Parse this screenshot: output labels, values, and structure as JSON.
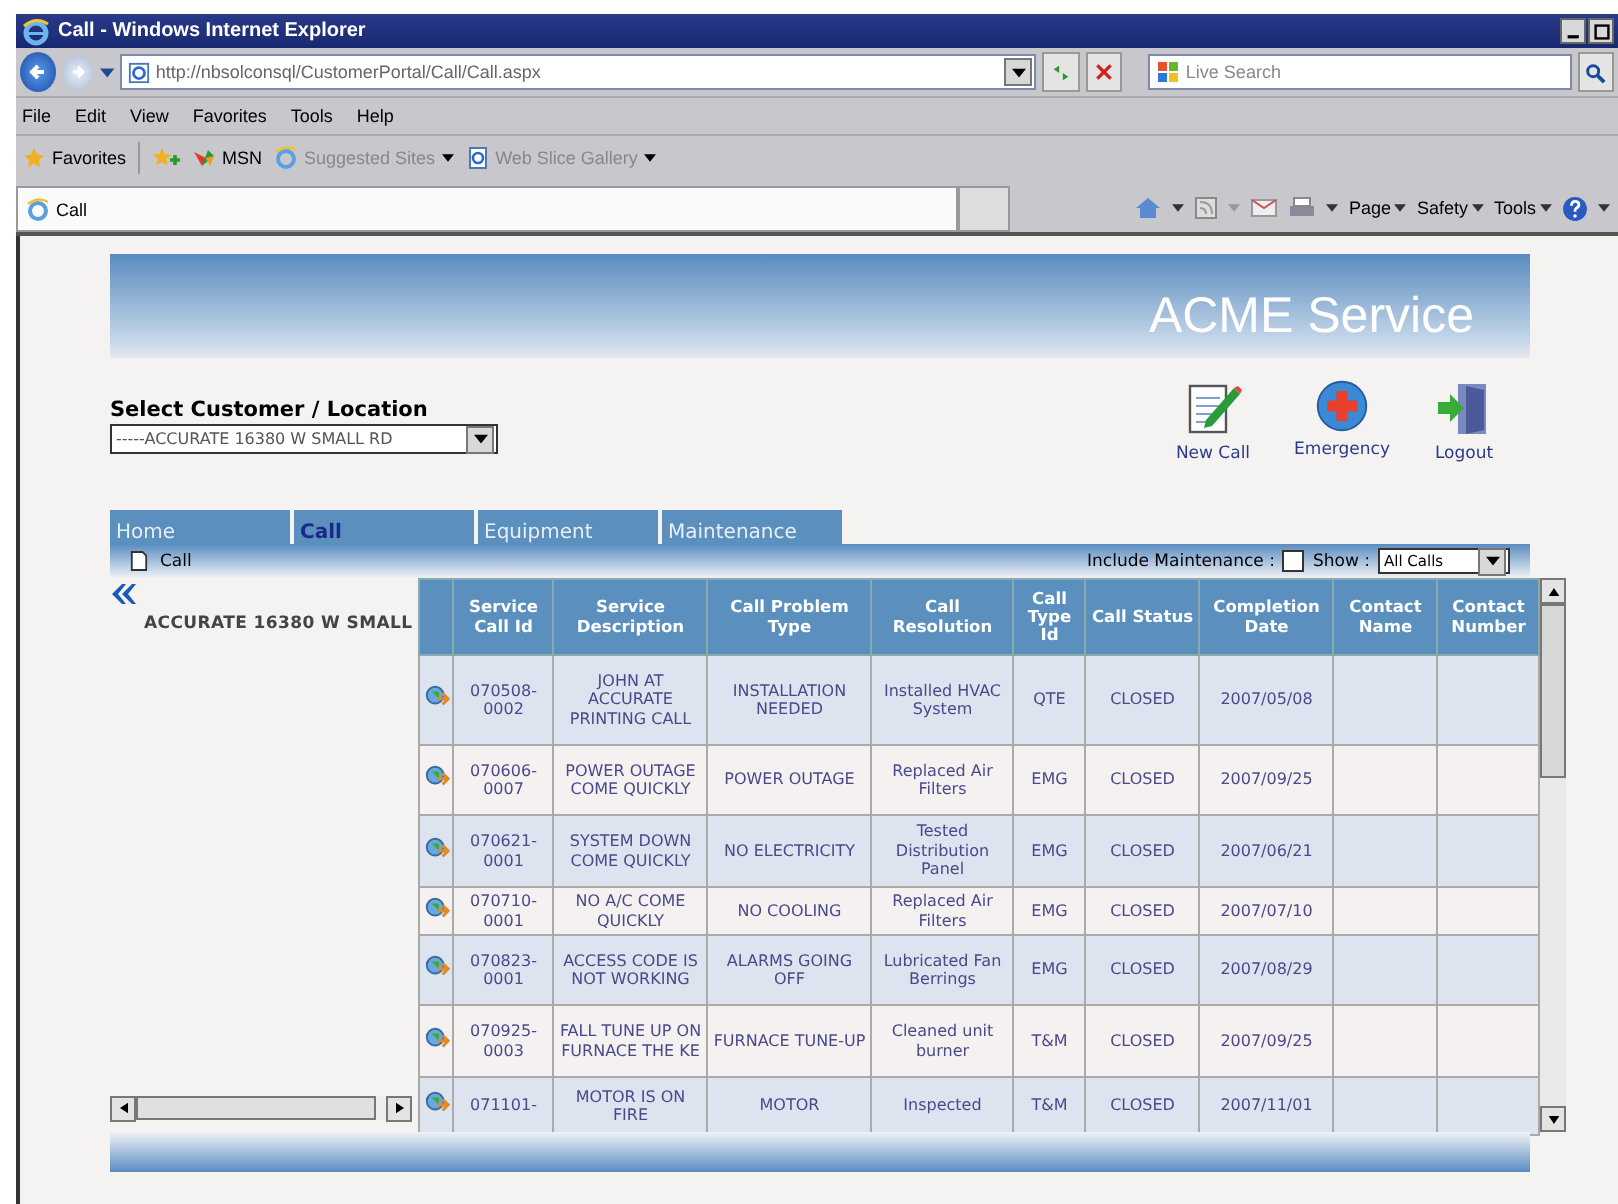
{
  "browser": {
    "title": "Call - Windows Internet Explorer",
    "url": "http://nbsolconsql/CustomerPortal/Call/Call.aspx",
    "search_placeholder": "Live Search",
    "menu": [
      "File",
      "Edit",
      "View",
      "Favorites",
      "Tools",
      "Help"
    ],
    "favorites": [
      {
        "label": "Favorites",
        "kind": "star",
        "dropdown": false,
        "disabled": false
      },
      {
        "label": "MSN",
        "kind": "msn",
        "dropdown": false,
        "disabled": false
      },
      {
        "label": "Suggested Sites",
        "kind": "ie",
        "dropdown": true,
        "disabled": true
      },
      {
        "label": "Web Slice Gallery",
        "kind": "page",
        "dropdown": true,
        "disabled": true
      }
    ],
    "tab_title": "Call",
    "commands": [
      "Page",
      "Safety",
      "Tools"
    ]
  },
  "app": {
    "title": "ACME Service",
    "customer_label": "Select Customer / Location",
    "customer_value": "-----ACCURATE 16380 W SMALL RD",
    "actions": [
      {
        "label": "New Call",
        "kind": "new"
      },
      {
        "label": "Emergency",
        "kind": "emergency"
      },
      {
        "label": "Logout",
        "kind": "logout"
      }
    ],
    "tabs": [
      {
        "label": "Home",
        "selected": false
      },
      {
        "label": "Call",
        "selected": true
      },
      {
        "label": "Equipment",
        "selected": false
      },
      {
        "label": "Maintenance",
        "selected": false
      }
    ],
    "section_title": "Call",
    "include_maintenance": {
      "label": "Include Maintenance :",
      "checked": false
    },
    "show": {
      "label": "Show :",
      "value": "All Calls"
    },
    "left_panel_text": "ACCURATE 16380 W SMALL",
    "table": {
      "columns": [
        "Service Call Id",
        "Service Description",
        "Call Problem Type",
        "Call Resolution",
        "Call Type Id",
        "Call Status",
        "Completion Date",
        "Contact Name",
        "Contact Number"
      ],
      "rows": [
        {
          "cells": [
            "070508-0002",
            "JOHN AT ACCURATE PRINTING CALL",
            "INSTALLATION NEEDED",
            "Installed HVAC System",
            "QTE",
            "CLOSED",
            "2007/05/08"
          ]
        },
        {
          "cells": [
            "070606-0007",
            "POWER OUTAGE COME QUICKLY",
            "POWER OUTAGE",
            "Replaced Air Filters",
            "EMG",
            "CLOSED",
            "2007/09/25"
          ]
        },
        {
          "cells": [
            "070621-0001",
            "SYSTEM DOWN COME QUICKLY",
            "NO ELECTRICITY",
            "Tested Distribution Panel",
            "EMG",
            "CLOSED",
            "2007/06/21"
          ]
        },
        {
          "cells": [
            "070710-0001",
            "NO A/C COME QUICKLY",
            "NO COOLING",
            "Replaced Air Filters",
            "EMG",
            "CLOSED",
            "2007/07/10"
          ]
        },
        {
          "cells": [
            "070823-0001",
            "ACCESS CODE IS NOT WORKING",
            "ALARMS GOING OFF",
            "Lubricated Fan Berrings",
            "EMG",
            "CLOSED",
            "2007/08/29"
          ]
        },
        {
          "cells": [
            "070925-0003",
            "FALL TUNE UP ON FURNACE THE KE",
            "FURNACE TUNE-UP",
            "Cleaned unit burner",
            "T&M",
            "CLOSED",
            "2007/09/25"
          ]
        },
        {
          "cells": [
            "071101-",
            "MOTOR IS ON FIRE",
            "MOTOR",
            "Inspected",
            "T&M",
            "CLOSED",
            "2007/11/01"
          ]
        }
      ]
    }
  }
}
